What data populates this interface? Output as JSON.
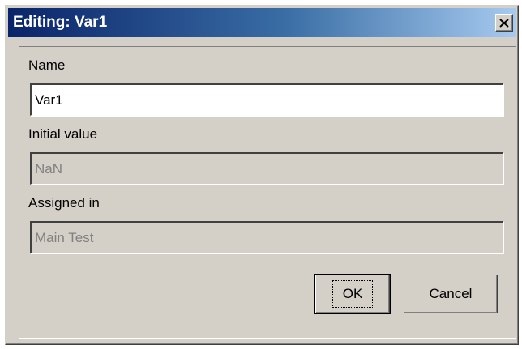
{
  "window": {
    "title": "Editing: Var1",
    "close_symbol": "✕",
    "close_icon": "close-icon"
  },
  "form": {
    "name_label": "Name",
    "name_value": "Var1",
    "initial_value_label": "Initial value",
    "initial_value_value": "NaN",
    "assigned_in_label": "Assigned in",
    "assigned_in_value": "Main Test"
  },
  "buttons": {
    "ok_label": "OK",
    "cancel_label": "Cancel"
  },
  "colors": {
    "titlebar_start": "#0a246a",
    "titlebar_end": "#a6caf0",
    "dialog_face": "#d4d0c8",
    "disabled_text": "#808080"
  }
}
